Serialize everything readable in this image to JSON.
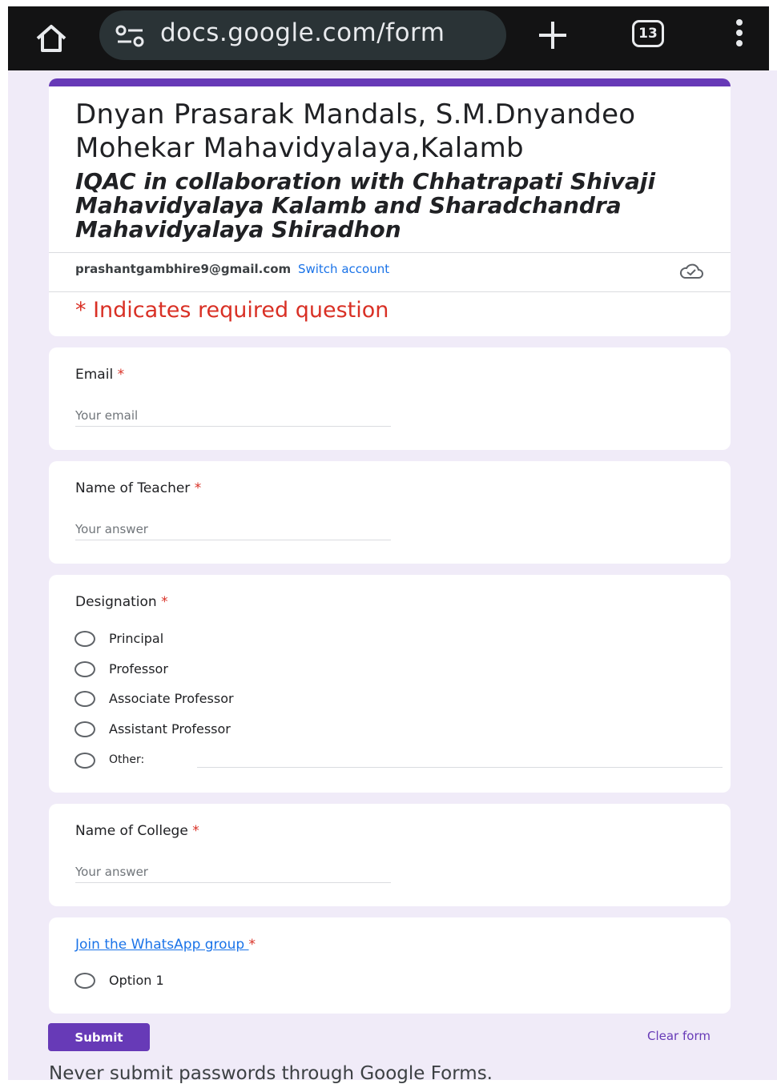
{
  "browser": {
    "url": "docs.google.com/form",
    "tab_count": "13",
    "icons": [
      "home-icon",
      "tune-icon",
      "new-tab-icon",
      "tab-switcher-icon",
      "overflow-menu-icon"
    ]
  },
  "form": {
    "title": "Dnyan Prasarak Mandals, S.M.Dnyandeo Mohekar Mahavidyalaya,Kalamb",
    "subtitle": " IQAC in  collaboration with Chhatrapati Shivaji Mahavidyalaya Kalamb and Sharadchandra Mahavidyalaya Shiradhon",
    "account_email": "prashantgambhire9@gmail.com",
    "switch_account": "Switch account",
    "required_note": "* Indicates required question",
    "accent_color": "#673ab7",
    "required_color": "#d93025"
  },
  "questions": {
    "email": {
      "label": "Email",
      "required": "*",
      "placeholder": "Your email"
    },
    "teacher": {
      "label": "Name of Teacher",
      "required": "*",
      "placeholder": "Your answer"
    },
    "designation": {
      "label": "Designation",
      "required": "*",
      "options": [
        "Principal",
        "Professor",
        "Associate Professor",
        "Assistant Professor",
        "Other:"
      ]
    },
    "college": {
      "label": "Name of College",
      "required": "*",
      "placeholder": "Your answer"
    },
    "whatsapp": {
      "label": "Join the WhatsApp group ",
      "required": "*",
      "options": [
        "Option 1"
      ]
    }
  },
  "footer": {
    "submit": "Submit",
    "clear": "Clear form",
    "warning": "Never submit passwords through Google Forms."
  }
}
